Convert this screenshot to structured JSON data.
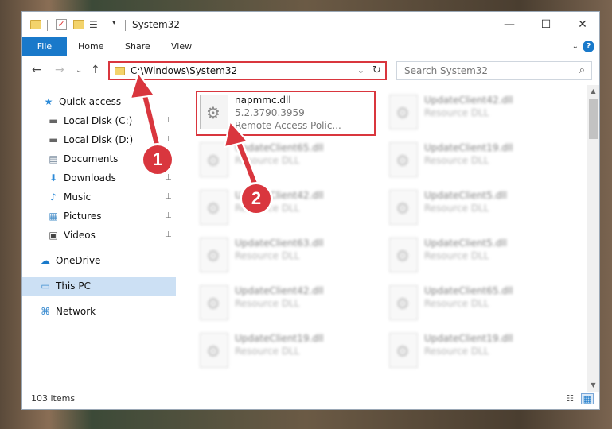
{
  "window": {
    "title": "System32",
    "minimize_glyph": "—",
    "maximize_glyph": "☐",
    "close_glyph": "✕"
  },
  "ribbon": {
    "tabs": [
      "File",
      "Home",
      "Share",
      "View"
    ],
    "help_glyph": "?",
    "collapse_glyph": "⌄"
  },
  "nav": {
    "back_glyph": "←",
    "forward_glyph": "→",
    "recent_glyph": "⌄",
    "up_glyph": "↑"
  },
  "address": {
    "path": "C:\\Windows\\System32",
    "dropdown_glyph": "⌄",
    "refresh_glyph": "↻"
  },
  "search": {
    "placeholder": "Search System32",
    "icon_glyph": "⌕"
  },
  "sidebar": {
    "items": [
      {
        "label": "Quick access",
        "icon": "star-icon",
        "glyph": "★",
        "color": "#2b8ad8"
      },
      {
        "label": "Local Disk (C:)",
        "icon": "drive-icon",
        "glyph": "▬",
        "color": "#666666",
        "pinned": true
      },
      {
        "label": "Local Disk (D:)",
        "icon": "drive-icon",
        "glyph": "▬",
        "color": "#666666",
        "pinned": true
      },
      {
        "label": "Documents",
        "icon": "documents-icon",
        "glyph": "▤",
        "color": "#6b7f94",
        "pinned": true
      },
      {
        "label": "Downloads",
        "icon": "downloads-icon",
        "glyph": "⬇",
        "color": "#2b8ad8",
        "pinned": true
      },
      {
        "label": "Music",
        "icon": "music-icon",
        "glyph": "♪",
        "color": "#2b8ad8",
        "pinned": true
      },
      {
        "label": "Pictures",
        "icon": "pictures-icon",
        "glyph": "▦",
        "color": "#4a90c9",
        "pinned": true
      },
      {
        "label": "Videos",
        "icon": "videos-icon",
        "glyph": "▣",
        "color": "#444444",
        "pinned": true
      },
      {
        "label": "OneDrive",
        "icon": "cloud-icon",
        "glyph": "☁",
        "color": "#1979ca"
      },
      {
        "label": "This PC",
        "icon": "computer-icon",
        "glyph": "▭",
        "color": "#3a8bd0",
        "selected": true
      },
      {
        "label": "Network",
        "icon": "network-icon",
        "glyph": "⌘",
        "color": "#3a8bd0"
      }
    ],
    "pin_glyph": "📌"
  },
  "files": {
    "highlighted": {
      "name": "napmmc.dll",
      "version": "5.2.3790.3959",
      "description": "Remote Access Polic..."
    },
    "left_column": [
      {
        "name": "UpdateClient65.dll",
        "description": "Resource DLL"
      },
      {
        "name": "UpdateClient42.dll",
        "description": "Resource DLL"
      },
      {
        "name": "UpdateClient63.dll",
        "description": "Resource DLL"
      },
      {
        "name": "UpdateClient42.dll",
        "description": "Resource DLL"
      },
      {
        "name": "UpdateClient19.dll",
        "description": "Resource DLL"
      }
    ],
    "right_column": [
      {
        "name": "UpdateClient42.dll",
        "description": "Resource DLL"
      },
      {
        "name": "UpdateClient19.dll",
        "description": "Resource DLL"
      },
      {
        "name": "UpdateClient5.dll",
        "description": "Resource DLL"
      },
      {
        "name": "UpdateClient5.dll",
        "description": "Resource DLL"
      },
      {
        "name": "UpdateClient65.dll",
        "description": "Resource DLL"
      },
      {
        "name": "UpdateClient19.dll",
        "description": "Resource DLL"
      }
    ]
  },
  "status": {
    "item_count": "103 items"
  },
  "annotations": {
    "step1": "1",
    "step2": "2",
    "accent": "#d9363e"
  },
  "colors": {
    "file_tab": "#1979ca",
    "selection": "#cce0f4"
  }
}
